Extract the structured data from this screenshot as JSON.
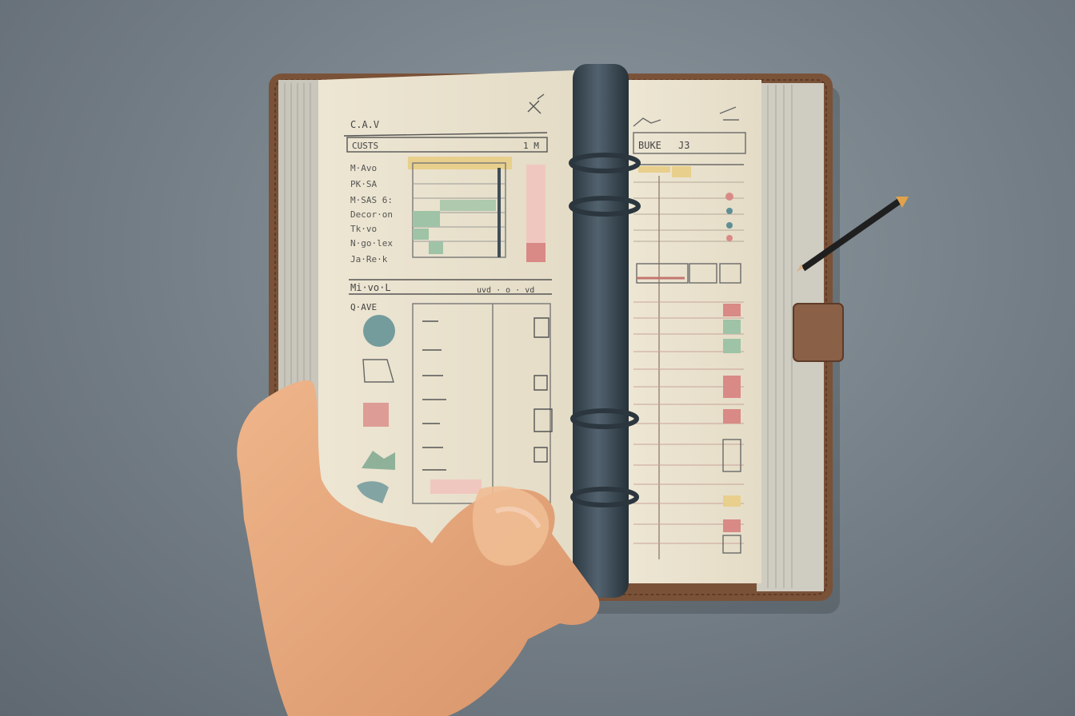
{
  "scene": {
    "left_page": {
      "header": "C.A.V",
      "tab_label": "CUSTS",
      "tab_code": "1 M",
      "rows": [
        "M·Avo",
        "PK·SA",
        "M·SAS 6:",
        "Decor·on",
        "Tk·vo",
        "N·go·lex",
        "Ja·Re·k"
      ],
      "section_title": "Mi·vo·L",
      "section_sub": "Q·AVE",
      "chart_note": "uvd · o · vd"
    },
    "right_page": {
      "header": "BUKE",
      "code": "J3"
    },
    "colors": {
      "paper": "#ece4d0",
      "cover": "#7a5238",
      "ring": "#3f4d58",
      "pencil": "#1f1f1f",
      "accent_green": "#7fa88f",
      "accent_red": "#d98a86",
      "accent_yellow": "#e8cf8c",
      "accent_teal": "#5f8f94",
      "skin": "#e6a77b"
    }
  }
}
